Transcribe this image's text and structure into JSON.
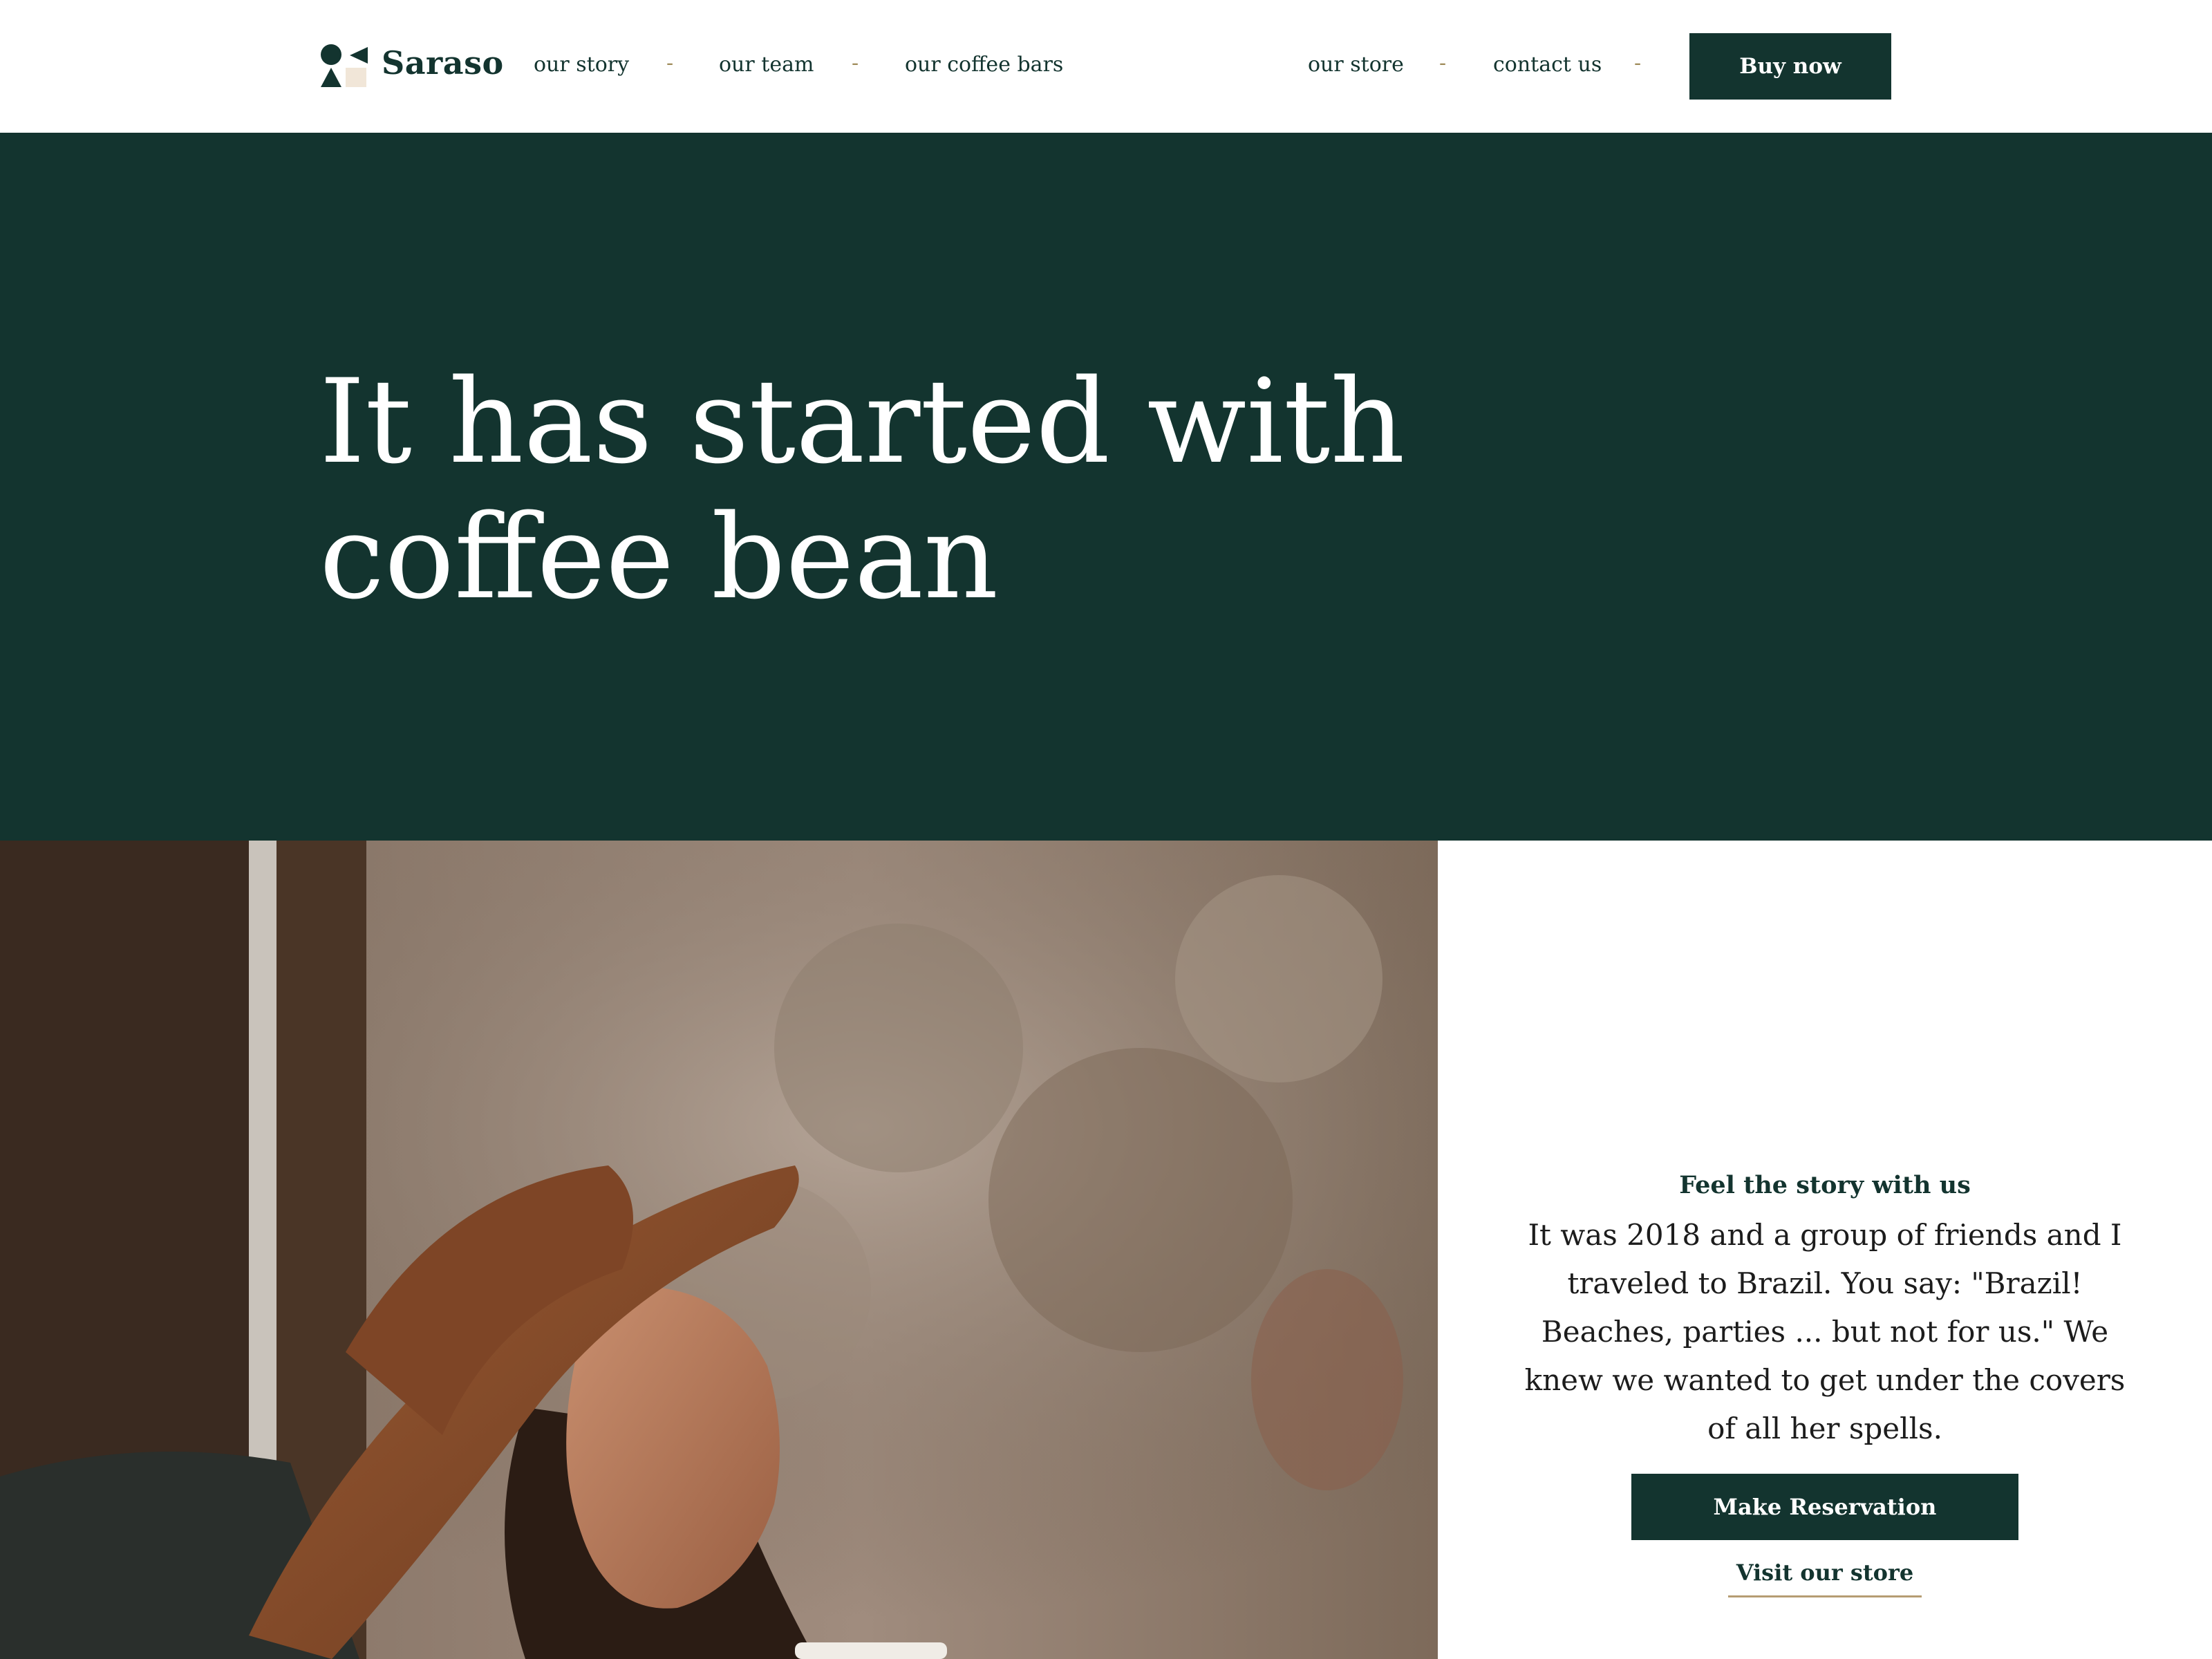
{
  "header": {
    "brand": "Saraso",
    "nav_left": [
      "our story",
      "our team",
      "our coffee bars"
    ],
    "nav_right": [
      "our store",
      "contact us"
    ],
    "separator": "-",
    "buy_label": "Buy now"
  },
  "hero": {
    "title": "It has started with coffee bean"
  },
  "story": {
    "kicker": "Feel the story with us",
    "text": "It was 2018 and a group of friends and I traveled to Brazil. You say: \"Brazil! Beaches, parties ... but not for us.\" We knew we wanted to get under the covers of all her spells.",
    "reserve_label": "Make Reservation",
    "visit_label": "Visit our store"
  },
  "colors": {
    "brand_dark": "#13342f",
    "accent_gold": "#b59d73",
    "background": "#ffffff"
  },
  "icons": {
    "logo": "saraso-logo-icon"
  }
}
